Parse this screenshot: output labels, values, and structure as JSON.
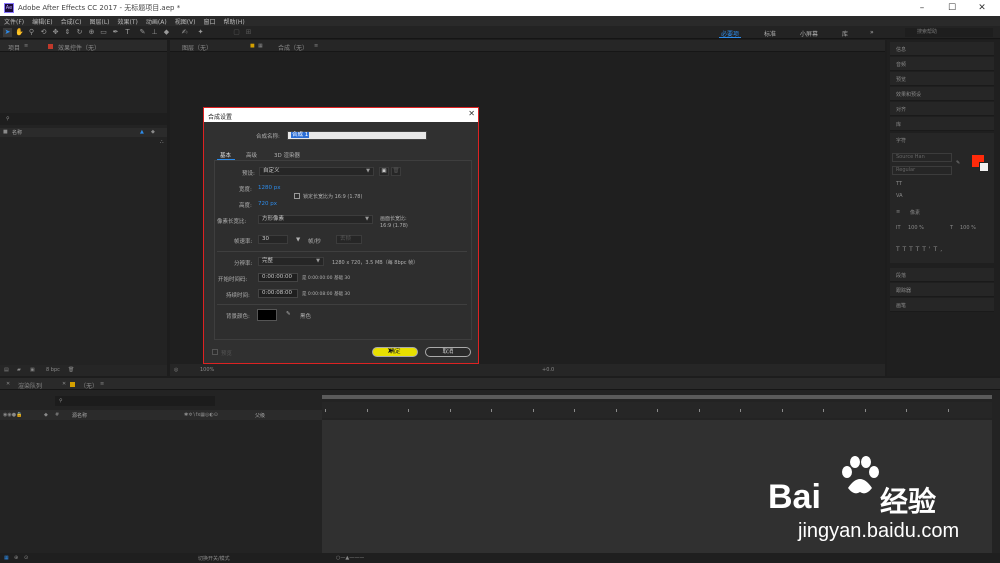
{
  "window": {
    "title": "Adobe After Effects CC 2017 - 无标题项目.aep *",
    "app_icon": "Ae",
    "controls": [
      "minimize-icon",
      "maximize-icon",
      "close-icon"
    ]
  },
  "menu": [
    "文件(F)",
    "编辑(E)",
    "合成(C)",
    "图层(L)",
    "效果(T)",
    "动画(A)",
    "视图(V)",
    "窗口",
    "帮助(H)"
  ],
  "workspaces": [
    "必要项",
    "标准",
    "小屏幕",
    "库"
  ],
  "workspace_more": "»",
  "search_help_placeholder": "搜索帮助",
  "project_panel": {
    "tabs": [
      "项目",
      "效果控件（无）"
    ],
    "column_name": "名称",
    "bpc": "8 bpc"
  },
  "comp_panel": {
    "tabs": [
      "图层（无）",
      "合成（无）"
    ],
    "zoom": "100%",
    "offset": "+0.0"
  },
  "right_panel": {
    "items": [
      "信息",
      "音频",
      "预览",
      "效果和预设",
      "对齐",
      "库",
      "字符",
      "段落",
      "跟踪器",
      "画笔"
    ],
    "char_font": "Source Han",
    "char_style": "Regular",
    "size1": "100 %",
    "size2": "100 %",
    "pixel_label": "像素"
  },
  "dialog": {
    "title": "合成设置",
    "name_label": "合成名称:",
    "name_value": "合成 1",
    "tabs": [
      "基本",
      "高级",
      "3D 渲染器"
    ],
    "preset_label": "预设:",
    "preset_value": "自定义",
    "width_label": "宽度:",
    "width_value": "1280 px",
    "height_label": "高度:",
    "height_value": "720 px",
    "lock_aspect": "锁定长宽比为 16:9 (1.78)",
    "pixel_aspect_label": "像素长宽比:",
    "pixel_aspect_value": "方形像素",
    "frame_aspect_label": "画面长宽比:",
    "frame_aspect_value": "16:9 (1.78)",
    "fps_label": "帧速率:",
    "fps_value": "30",
    "fps_unit": "帧/秒",
    "fps_drop": "丢帧",
    "resolution_label": "分辨率:",
    "resolution_value": "完整",
    "resolution_info": "1280 x 720，3.5 MB（每 8bpc 帧）",
    "start_label": "开始时间码:",
    "start_value": "0:00:00:00",
    "start_info": "是 0:00:00:00  基础 30",
    "duration_label": "持续时间:",
    "duration_value": "0:00:08:00",
    "duration_info": "是 0:00:08:00  基础 30",
    "bg_label": "背景颜色:",
    "bg_name": "黑色",
    "preview_label": "预览",
    "ok_label": "确定",
    "cancel_label": "取消"
  },
  "timeline": {
    "tabs": [
      "渲染队列",
      "（无）"
    ],
    "col_source": "源名称",
    "col_parent": "父级",
    "toggle_label": "切换开关/模式"
  },
  "watermark": {
    "brand": "Bai",
    "brand2": "经验",
    "url": "jingyan.baidu.com"
  },
  "colors": {
    "accent": "#2d8ceb",
    "dialog_border": "#dd2222",
    "ok_button": "#e8e000",
    "swatch_fg": "#ff2a0a"
  }
}
